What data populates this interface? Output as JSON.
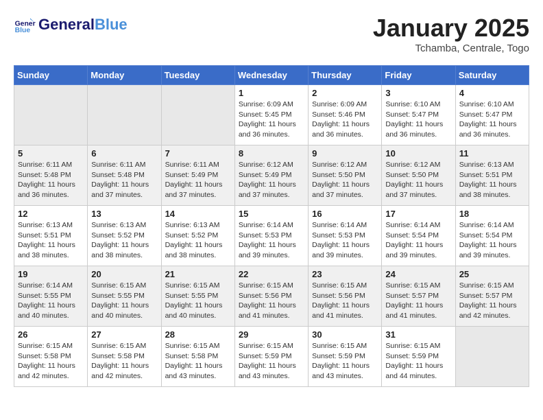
{
  "header": {
    "logo_general": "General",
    "logo_blue": "Blue",
    "month": "January 2025",
    "location": "Tchamba, Centrale, Togo"
  },
  "weekdays": [
    "Sunday",
    "Monday",
    "Tuesday",
    "Wednesday",
    "Thursday",
    "Friday",
    "Saturday"
  ],
  "weeks": [
    [
      {
        "day": "",
        "info": ""
      },
      {
        "day": "",
        "info": ""
      },
      {
        "day": "",
        "info": ""
      },
      {
        "day": "1",
        "info": "Sunrise: 6:09 AM\nSunset: 5:45 PM\nDaylight: 11 hours\nand 36 minutes."
      },
      {
        "day": "2",
        "info": "Sunrise: 6:09 AM\nSunset: 5:46 PM\nDaylight: 11 hours\nand 36 minutes."
      },
      {
        "day": "3",
        "info": "Sunrise: 6:10 AM\nSunset: 5:47 PM\nDaylight: 11 hours\nand 36 minutes."
      },
      {
        "day": "4",
        "info": "Sunrise: 6:10 AM\nSunset: 5:47 PM\nDaylight: 11 hours\nand 36 minutes."
      }
    ],
    [
      {
        "day": "5",
        "info": "Sunrise: 6:11 AM\nSunset: 5:48 PM\nDaylight: 11 hours\nand 36 minutes."
      },
      {
        "day": "6",
        "info": "Sunrise: 6:11 AM\nSunset: 5:48 PM\nDaylight: 11 hours\nand 37 minutes."
      },
      {
        "day": "7",
        "info": "Sunrise: 6:11 AM\nSunset: 5:49 PM\nDaylight: 11 hours\nand 37 minutes."
      },
      {
        "day": "8",
        "info": "Sunrise: 6:12 AM\nSunset: 5:49 PM\nDaylight: 11 hours\nand 37 minutes."
      },
      {
        "day": "9",
        "info": "Sunrise: 6:12 AM\nSunset: 5:50 PM\nDaylight: 11 hours\nand 37 minutes."
      },
      {
        "day": "10",
        "info": "Sunrise: 6:12 AM\nSunset: 5:50 PM\nDaylight: 11 hours\nand 37 minutes."
      },
      {
        "day": "11",
        "info": "Sunrise: 6:13 AM\nSunset: 5:51 PM\nDaylight: 11 hours\nand 38 minutes."
      }
    ],
    [
      {
        "day": "12",
        "info": "Sunrise: 6:13 AM\nSunset: 5:51 PM\nDaylight: 11 hours\nand 38 minutes."
      },
      {
        "day": "13",
        "info": "Sunrise: 6:13 AM\nSunset: 5:52 PM\nDaylight: 11 hours\nand 38 minutes."
      },
      {
        "day": "14",
        "info": "Sunrise: 6:13 AM\nSunset: 5:52 PM\nDaylight: 11 hours\nand 38 minutes."
      },
      {
        "day": "15",
        "info": "Sunrise: 6:14 AM\nSunset: 5:53 PM\nDaylight: 11 hours\nand 39 minutes."
      },
      {
        "day": "16",
        "info": "Sunrise: 6:14 AM\nSunset: 5:53 PM\nDaylight: 11 hours\nand 39 minutes."
      },
      {
        "day": "17",
        "info": "Sunrise: 6:14 AM\nSunset: 5:54 PM\nDaylight: 11 hours\nand 39 minutes."
      },
      {
        "day": "18",
        "info": "Sunrise: 6:14 AM\nSunset: 5:54 PM\nDaylight: 11 hours\nand 39 minutes."
      }
    ],
    [
      {
        "day": "19",
        "info": "Sunrise: 6:14 AM\nSunset: 5:55 PM\nDaylight: 11 hours\nand 40 minutes."
      },
      {
        "day": "20",
        "info": "Sunrise: 6:15 AM\nSunset: 5:55 PM\nDaylight: 11 hours\nand 40 minutes."
      },
      {
        "day": "21",
        "info": "Sunrise: 6:15 AM\nSunset: 5:55 PM\nDaylight: 11 hours\nand 40 minutes."
      },
      {
        "day": "22",
        "info": "Sunrise: 6:15 AM\nSunset: 5:56 PM\nDaylight: 11 hours\nand 41 minutes."
      },
      {
        "day": "23",
        "info": "Sunrise: 6:15 AM\nSunset: 5:56 PM\nDaylight: 11 hours\nand 41 minutes."
      },
      {
        "day": "24",
        "info": "Sunrise: 6:15 AM\nSunset: 5:57 PM\nDaylight: 11 hours\nand 41 minutes."
      },
      {
        "day": "25",
        "info": "Sunrise: 6:15 AM\nSunset: 5:57 PM\nDaylight: 11 hours\nand 42 minutes."
      }
    ],
    [
      {
        "day": "26",
        "info": "Sunrise: 6:15 AM\nSunset: 5:58 PM\nDaylight: 11 hours\nand 42 minutes."
      },
      {
        "day": "27",
        "info": "Sunrise: 6:15 AM\nSunset: 5:58 PM\nDaylight: 11 hours\nand 42 minutes."
      },
      {
        "day": "28",
        "info": "Sunrise: 6:15 AM\nSunset: 5:58 PM\nDaylight: 11 hours\nand 43 minutes."
      },
      {
        "day": "29",
        "info": "Sunrise: 6:15 AM\nSunset: 5:59 PM\nDaylight: 11 hours\nand 43 minutes."
      },
      {
        "day": "30",
        "info": "Sunrise: 6:15 AM\nSunset: 5:59 PM\nDaylight: 11 hours\nand 43 minutes."
      },
      {
        "day": "31",
        "info": "Sunrise: 6:15 AM\nSunset: 5:59 PM\nDaylight: 11 hours\nand 44 minutes."
      },
      {
        "day": "",
        "info": ""
      }
    ]
  ]
}
